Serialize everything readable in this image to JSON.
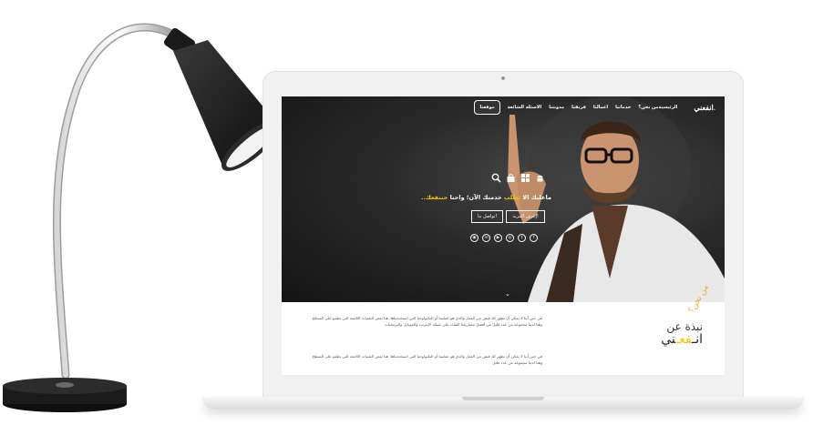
{
  "nav": {
    "logo": "انفعني",
    "items": [
      "الرئيسية",
      "من نحن؟",
      "خدماتنا",
      "اعمالنا",
      "فريقنا",
      "مدونتنا",
      "الاسئلة الشائعة"
    ],
    "cta": "موقعنا"
  },
  "hero": {
    "tagline_prefix": "ماعليك الا",
    "tagline_hl1": "تطلب",
    "tagline_mid": "خدمتك الآن؛ واحنا",
    "tagline_hl2": "حننفعك..",
    "learn_more": "إعرف المزيد!",
    "contact": "تواصل بنا!",
    "icons": [
      "search-icon",
      "shopping-bag-icon",
      "windows-icon",
      "android-icon"
    ],
    "socials": [
      "facebook",
      "twitter",
      "instagram",
      "youtube",
      "linkedin",
      "github"
    ]
  },
  "about": {
    "side_small": "من نحن؟",
    "title": "نبذة عن",
    "brand_a": "انـ",
    "brand_b": "فعـ",
    "brand_c": "ني",
    "para1": "في حين أننا لا يمكن أن تظهر لك فيض من العمل والذي هو عمليتنا أو التكنولوجيا التي استخدمناها، هنا بعض التقنيات اللامعة التي تطفو على السطح. وهنا لدينا مجموعة من عدد قليل من أفضل مشاريعنا القناة، على شبكة الإنترنت والموبايل والبرمجيات",
    "para2": "في حين أننا لا يمكن أن تظهر لك فيض من العمل والذي هو عمليتنا أو التكنولوجيا التي استخدمناها، هنا بعض التقنيات اللامعة التي تطفو على السطح. وهنا لدينا مجموعة من عدد قليل"
  },
  "colors": {
    "accent": "#f5c500",
    "hero_bg": "#1c1c1c"
  }
}
